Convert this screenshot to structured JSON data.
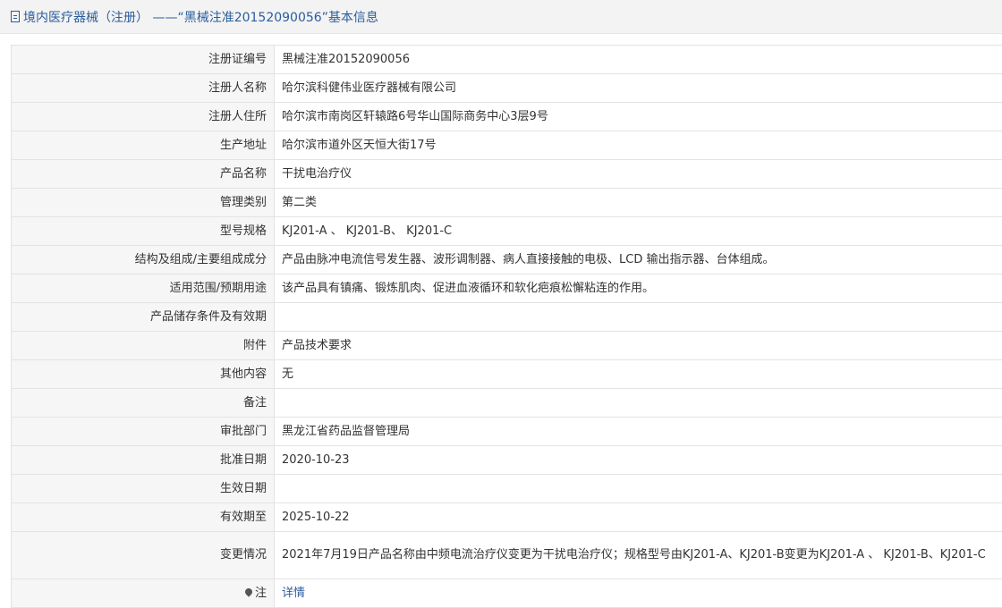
{
  "header": {
    "title": "境内医疗器械（注册） ——“黑械注准20152090056”基本信息"
  },
  "fields": [
    {
      "label": "注册证编号",
      "value": "黑械注准20152090056"
    },
    {
      "label": "注册人名称",
      "value": "哈尔滨科健伟业医疗器械有限公司"
    },
    {
      "label": "注册人住所",
      "value": "哈尔滨市南岗区轩辕路6号华山国际商务中心3层9号"
    },
    {
      "label": "生产地址",
      "value": "哈尔滨市道外区天恒大街17号"
    },
    {
      "label": "产品名称",
      "value": "干扰电治疗仪"
    },
    {
      "label": "管理类别",
      "value": "第二类"
    },
    {
      "label": "型号规格",
      "value": "KJ201-A 、 KJ201-B、 KJ201-C"
    },
    {
      "label": "结构及组成/主要组成成分",
      "value": "产品由脉冲电流信号发生器、波形调制器、病人直接接触的电极、LCD 输出指示器、台体组成。"
    },
    {
      "label": "适用范围/预期用途",
      "value": "该产品具有镇痛、锻炼肌肉、促进血液循环和软化疤痕松懈粘连的作用。"
    },
    {
      "label": "产品储存条件及有效期",
      "value": ""
    },
    {
      "label": "附件",
      "value": "产品技术要求"
    },
    {
      "label": "其他内容",
      "value": "无"
    },
    {
      "label": "备注",
      "value": ""
    },
    {
      "label": "审批部门",
      "value": "黑龙江省药品监督管理局"
    },
    {
      "label": "批准日期",
      "value": "2020-10-23"
    },
    {
      "label": "生效日期",
      "value": ""
    },
    {
      "label": "有效期至",
      "value": "2025-10-22"
    },
    {
      "label": "变更情况",
      "value": "2021年7月19日产品名称由中频电流治疗仪变更为干扰电治疗仪；规格型号由KJ201-A、KJ201-B变更为KJ201-A 、 KJ201-B、KJ201-C"
    }
  ],
  "note": {
    "label": "注",
    "link_text": "详情"
  },
  "colors": {
    "accent": "#2a5d9e",
    "label_bg": "#f6f6f6",
    "border": "#e3e3e3"
  }
}
